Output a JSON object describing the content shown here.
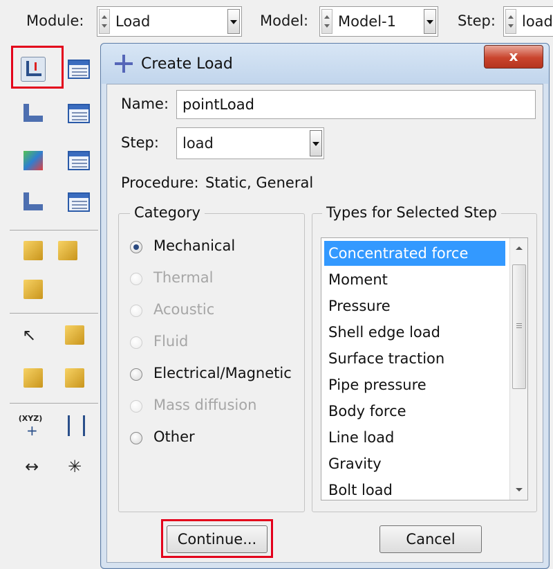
{
  "context_bar": {
    "module_label": "Module:",
    "module_value": "Load",
    "model_label": "Model:",
    "model_value": "Model-1",
    "step_label": "Step:",
    "step_value": "load"
  },
  "toolbox": {
    "icons": [
      "create-load-icon",
      "load-manager-icon",
      "create-bc-icon",
      "bc-manager-icon",
      "create-predefined-field-icon",
      "predefined-field-manager-icon",
      "create-load-case-icon",
      "load-case-manager-icon",
      "coordinate-system-icon",
      "datum-csys-icon"
    ],
    "csys_text": "(XYZ)",
    "highlight_color": "#e3001b"
  },
  "dialog": {
    "title": "Create Load",
    "close_label": "x",
    "name_label": "Name:",
    "name_value": "pointLoad",
    "step_label": "Step:",
    "step_value": "load",
    "procedure_label": "Procedure:",
    "procedure_value": "Static, General",
    "category": {
      "title": "Category",
      "options": [
        {
          "label": "Mechanical",
          "checked": true,
          "enabled": true
        },
        {
          "label": "Thermal",
          "checked": false,
          "enabled": false
        },
        {
          "label": "Acoustic",
          "checked": false,
          "enabled": false
        },
        {
          "label": "Fluid",
          "checked": false,
          "enabled": false
        },
        {
          "label": "Electrical/Magnetic",
          "checked": false,
          "enabled": true
        },
        {
          "label": "Mass diffusion",
          "checked": false,
          "enabled": false
        },
        {
          "label": "Other",
          "checked": false,
          "enabled": true
        }
      ]
    },
    "types": {
      "title": "Types for Selected Step",
      "items": [
        "Concentrated force",
        "Moment",
        "Pressure",
        "Shell edge load",
        "Surface traction",
        "Pipe pressure",
        "Body force",
        "Line load",
        "Gravity",
        "Bolt load"
      ],
      "selected": "Concentrated force",
      "selection_color": "#3399ff"
    },
    "continue_label": "Continue...",
    "cancel_label": "Cancel"
  }
}
